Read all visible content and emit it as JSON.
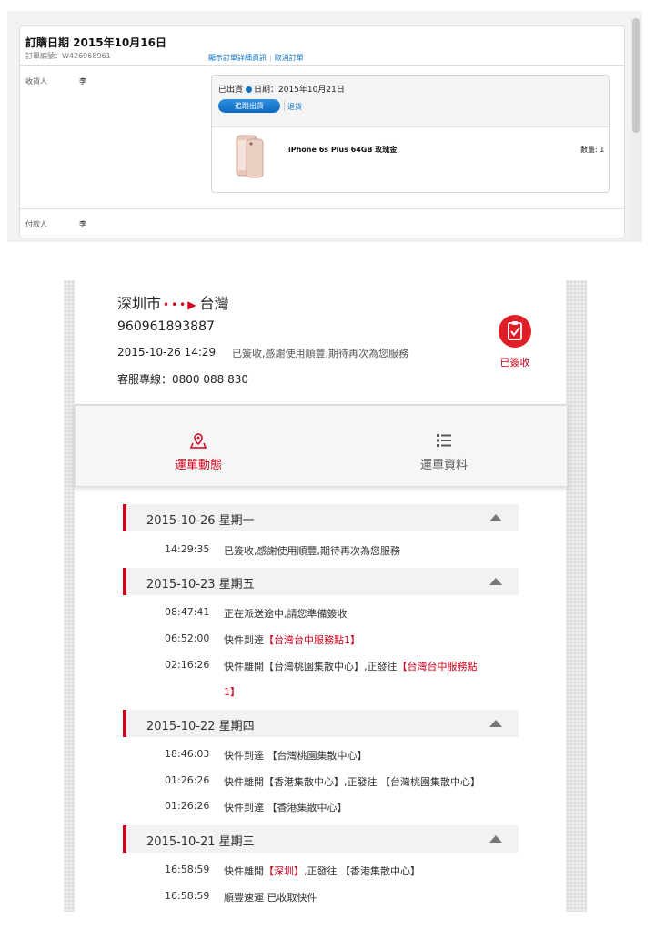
{
  "order": {
    "title": "訂購日期 2015年10月16日",
    "order_number": "訂單編號：W426968961",
    "link_details": "顯示訂單詳細資訊",
    "link_cancel": "取消訂單",
    "recipient_label": "收貨人",
    "recipient_value": "李",
    "payer_label": "付款人",
    "payer_value": "李",
    "shipment": {
      "status": "已出貨",
      "date_text": "日期：2015年10月21日",
      "track_button": "追蹤出貨",
      "return_link": "退貨",
      "product_name": "iPhone 6s Plus 64GB 玫瑰金",
      "quantity": "數量: 1"
    }
  },
  "tracking": {
    "route_from": "深圳市",
    "route_dots": "•••▶",
    "route_to": "台灣",
    "tracking_number": "960961893887",
    "last_time": "2015-10-26 14:29",
    "last_desc": "已簽收,感謝使用順豐,期待再次為您服務",
    "hotline": "客服專線：0800 088 830",
    "status_badge": "已簽收",
    "tabs": {
      "dynamics": "運單動態",
      "info": "運單資料"
    },
    "days": [
      {
        "date": "2015-10-26 星期一",
        "events": [
          {
            "time": "14:29:35",
            "desc": "已簽收,感謝使用順豐,期待再次為您服務"
          }
        ]
      },
      {
        "date": "2015-10-23 星期五",
        "events": [
          {
            "time": "08:47:41",
            "desc": "正在派送途中,請您準備簽收"
          },
          {
            "time": "06:52:00",
            "desc_a": "快件到達",
            "desc_red": "【台灣台中服務點1】"
          },
          {
            "time": "02:16:26",
            "desc_a": "快件離開【台灣桃園集散中心】,正發往",
            "desc_red": "【台灣台中服務點",
            "desc_red2": "1】"
          }
        ]
      },
      {
        "date": "2015-10-22 星期四",
        "events": [
          {
            "time": "18:46:03",
            "desc": "快件到達 【台灣桃園集散中心】"
          },
          {
            "time": "01:26:26",
            "desc": "快件離開【香港集散中心】,正發往 【台灣桃園集散中心】"
          },
          {
            "time": "01:26:26",
            "desc": "快件到達 【香港集散中心】"
          }
        ]
      },
      {
        "date": "2015-10-21 星期三",
        "events": [
          {
            "time": "16:58:59",
            "desc_a": "快件離開",
            "desc_red": "【深圳】",
            "desc_b": ",正發往 【香港集散中心】"
          },
          {
            "time": "16:58:59",
            "desc": "順豐速運 已收取快件"
          }
        ]
      }
    ]
  }
}
